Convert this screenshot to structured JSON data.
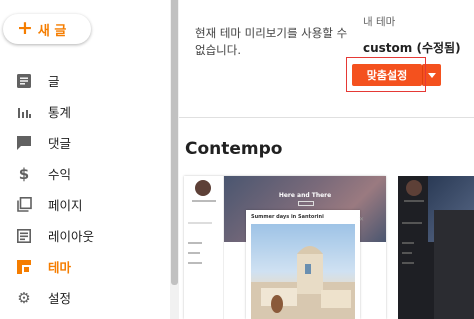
{
  "sidebar": {
    "new_post": {
      "plus": "+",
      "label": "새 글"
    },
    "items": [
      {
        "label": "글",
        "icon": "post-icon",
        "active": false
      },
      {
        "label": "통계",
        "icon": "stats-icon",
        "active": false
      },
      {
        "label": "댓글",
        "icon": "comment-icon",
        "active": false
      },
      {
        "label": "수익",
        "icon": "dollar-icon",
        "active": false
      },
      {
        "label": "페이지",
        "icon": "pages-icon",
        "active": false
      },
      {
        "label": "레이아웃",
        "icon": "layout-icon",
        "active": false
      },
      {
        "label": "테마",
        "icon": "theme-icon",
        "active": true
      },
      {
        "label": "설정",
        "icon": "gear-icon",
        "active": false
      }
    ]
  },
  "main": {
    "preview_note": "현재 테마 미리보기를 사용할 수 없습니다.",
    "my_theme_label": "내 테마",
    "theme_name": "custom (수정됨)",
    "customize_button": "맞춤설정",
    "section_title": "Contempo",
    "thumbnail": {
      "hero_title": "Here and There",
      "post_title": "Summer days in Santorini"
    }
  },
  "colors": {
    "accent": "#f57d00",
    "button": "#f4511e",
    "highlight_border": "#e53935"
  }
}
